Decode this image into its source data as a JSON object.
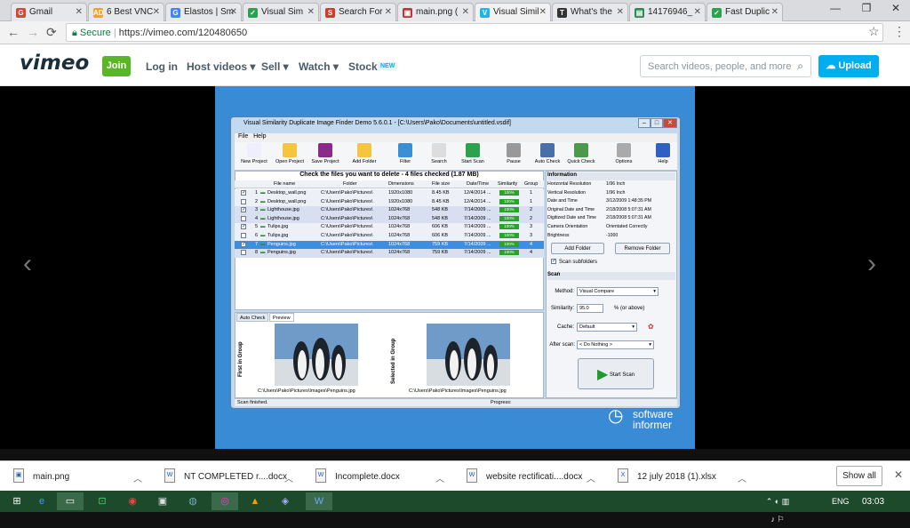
{
  "browser": {
    "tabs": [
      {
        "label": "Gmail",
        "fav": "G",
        "color": "#d44638"
      },
      {
        "label": "6 Best VNC",
        "fav": "AD",
        "color": "#f4a21c"
      },
      {
        "label": "Elastos | Sm",
        "fav": "G",
        "color": "#4285f4"
      },
      {
        "label": "Visual Sim",
        "fav": "✓",
        "color": "#2ca24c"
      },
      {
        "label": "Search For",
        "fav": "S",
        "color": "#d13a2c"
      },
      {
        "label": "main.png (",
        "fav": "▣",
        "color": "#b13b3b"
      },
      {
        "label": "Visual Simil",
        "fav": "V",
        "color": "#1ab7ea"
      },
      {
        "label": "What's the",
        "fav": "T",
        "color": "#333333"
      },
      {
        "label": "14176946_",
        "fav": "▤",
        "color": "#2e8b57"
      },
      {
        "label": "Fast Duplic",
        "fav": "✓",
        "color": "#2ca24c"
      }
    ],
    "secure_label": "Secure",
    "url": "https://vimeo.com/120480650"
  },
  "vimeo": {
    "logo": "vimeo",
    "join": "Join",
    "nav": [
      "Log in",
      "Host videos ▾",
      "Sell ▾",
      "Watch ▾",
      "Stock"
    ],
    "new_badge": "NEW",
    "search_placeholder": "Search videos, people, and more",
    "upload": "Upload"
  },
  "watermark": {
    "line1": "software",
    "line2": "informer"
  },
  "app": {
    "title": "Visual Similarity Duplicate Image Finder Demo 5.6.0.1 - [C:\\Users\\Pako\\Documents\\untitled.vsdif]",
    "menu": [
      "File",
      "Help"
    ],
    "toolbar": [
      "New Project",
      "Open Project",
      "Save Project",
      "Add Folder",
      "Filter",
      "Search",
      "Start Scan",
      "Pause",
      "Auto Check",
      "Quick Check",
      "Options",
      "Help"
    ],
    "check_header": "Check the files you want to delete - 4 files checked (1.87 MB)",
    "columns": [
      "File name",
      "Folder",
      "Dimensions",
      "File size",
      "Date/Time",
      "Similarity",
      "Group"
    ],
    "rows": [
      {
        "checked": true,
        "num": "1",
        "name": "Desktop_wall.png",
        "folder": "C:\\Users\\Pako\\Pictures\\",
        "dim": "1920x1080",
        "size": "8.45 KB",
        "date": "12/4/2014 ...",
        "sim": "100%",
        "group": "1"
      },
      {
        "checked": false,
        "num": "2",
        "name": "Desktop_wall.png",
        "folder": "C:\\Users\\Pako\\Pictures\\",
        "dim": "1920x1080",
        "size": "8.45 KB",
        "date": "12/4/2014 ...",
        "sim": "100%",
        "group": "1"
      },
      {
        "checked": true,
        "num": "3",
        "name": "Lighthouse.jpg",
        "folder": "C:\\Users\\Pako\\Pictures\\",
        "dim": "1024x768",
        "size": "548 KB",
        "date": "7/14/2009 ...",
        "sim": "100%",
        "group": "2"
      },
      {
        "checked": false,
        "num": "4",
        "name": "Lighthouse.jpg",
        "folder": "C:\\Users\\Pako\\Pictures\\",
        "dim": "1024x768",
        "size": "548 KB",
        "date": "7/14/2009 ...",
        "sim": "100%",
        "group": "2"
      },
      {
        "checked": true,
        "num": "5",
        "name": "Tulips.jpg",
        "folder": "C:\\Users\\Pako\\Pictures\\",
        "dim": "1024x768",
        "size": "606 KB",
        "date": "7/14/2009 ...",
        "sim": "100%",
        "group": "3"
      },
      {
        "checked": false,
        "num": "6",
        "name": "Tulips.jpg",
        "folder": "C:\\Users\\Pako\\Pictures\\",
        "dim": "1024x768",
        "size": "606 KB",
        "date": "7/14/2009 ...",
        "sim": "100%",
        "group": "3"
      },
      {
        "checked": true,
        "num": "7",
        "name": "Penguins.jpg",
        "folder": "C:\\Users\\Pako\\Pictures\\",
        "dim": "1024x768",
        "size": "759 KB",
        "date": "7/14/2009 ...",
        "sim": "100%",
        "group": "4",
        "selected": true
      },
      {
        "checked": false,
        "num": "8",
        "name": "Penguins.jpg",
        "folder": "C:\\Users\\Pako\\Pictures\\",
        "dim": "1024x768",
        "size": "759 KB",
        "date": "7/14/2009 ...",
        "sim": "100%",
        "group": "4"
      }
    ],
    "preview_tabs": [
      "Auto Check",
      "Preview"
    ],
    "first_in_group": "First in Group",
    "selected_in_group": "Selected in Group",
    "preview_path": "C:\\Users\\Pako\\Pictures\\Images\\Penguins.jpg",
    "status": "Scan finished.",
    "progress_label": "Progress:",
    "info_header": "Information",
    "info": [
      [
        "Horizontal Resolution",
        "1/96 Inch"
      ],
      [
        "Vertical Resolution",
        "1/96 Inch"
      ],
      [
        "Date and Time",
        "3/12/2009 1:48:35 PM"
      ],
      [
        "Original Date and Time",
        "2/18/2008 5:07:31 AM"
      ],
      [
        "Digitized Date and Time",
        "2/18/2008 5:07:31 AM"
      ],
      [
        "Camera Orientation",
        "Orientated Correctly"
      ],
      [
        "Brightness",
        "-1000"
      ]
    ],
    "add_folder": "Add Folder",
    "remove_folder": "Remove Folder",
    "scan_subfolders": "Scan subfolders",
    "scan_header": "Scan",
    "method_label": "Method:",
    "method_value": "Visual Compare",
    "similarity_label": "Similarity:",
    "similarity_value": "95.0",
    "similarity_suffix": "% (or above)",
    "cache_label": "Cache:",
    "cache_value": "Default",
    "after_scan_label": "After scan:",
    "after_scan_value": "< Do Nothing >",
    "start_scan": "Start Scan"
  },
  "downloads": {
    "items": [
      {
        "name": "main.png",
        "icon": "▣"
      },
      {
        "name": "NT COMPLETED r....docx",
        "icon": "W"
      },
      {
        "name": "Incomplete.docx",
        "icon": "W"
      },
      {
        "name": "website rectificati....docx",
        "icon": "W"
      },
      {
        "name": "12 july 2018 (1).xlsx",
        "icon": "X"
      }
    ],
    "show_all": "Show all"
  },
  "taskbar": {
    "lang": "ENG",
    "time": "03:03"
  }
}
